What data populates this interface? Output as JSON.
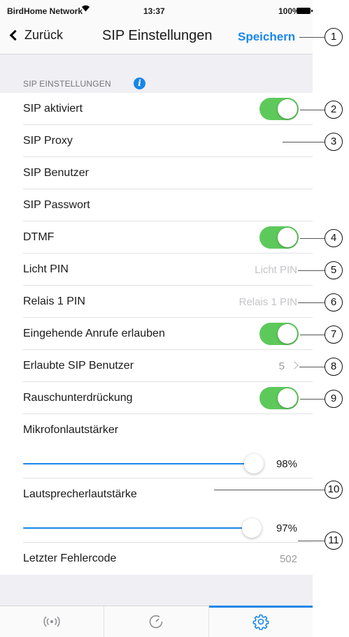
{
  "status_bar": {
    "carrier": "BirdHome Network",
    "wifi_icon": "wifi-icon",
    "time": "13:37",
    "battery": "100%"
  },
  "nav": {
    "back_label": "Zurück",
    "title": "SIP Einstellungen",
    "save_label": "Speichern"
  },
  "section": {
    "title": "SIP EINSTELLUNGEN",
    "info_glyph": "i"
  },
  "rows": {
    "sip_enabled": {
      "label": "SIP aktiviert",
      "toggle": true
    },
    "sip_proxy": {
      "label": "SIP Proxy"
    },
    "sip_user": {
      "label": "SIP Benutzer"
    },
    "sip_password": {
      "label": "SIP Passwort"
    },
    "dtmf": {
      "label": "DTMF",
      "toggle": true
    },
    "light_pin": {
      "label": "Licht PIN",
      "placeholder": "Licht PIN"
    },
    "relay_pin": {
      "label": "Relais 1 PIN",
      "placeholder": "Relais 1 PIN"
    },
    "incoming_calls": {
      "label": "Eingehende Anrufe erlauben",
      "toggle": true
    },
    "allowed_users": {
      "label": "Erlaubte SIP Benutzer",
      "value": "5"
    },
    "noise_suppression": {
      "label": "Rauschunterdrückung",
      "toggle": true
    },
    "mic_volume": {
      "label": "Mikrofonlautstärker",
      "value_text": "98%",
      "value": 0.98
    },
    "speaker_volume": {
      "label": "Lautsprecherlautstärke",
      "value_text": "97%",
      "value": 0.97
    },
    "last_error": {
      "label": "Letzter Fehlercode",
      "value": "502"
    }
  },
  "tabs": [
    {
      "icon": "broadcast-icon",
      "active": false
    },
    {
      "icon": "clock-icon",
      "active": false
    },
    {
      "icon": "gear-icon",
      "active": true
    }
  ],
  "callouts": [
    "1",
    "2",
    "3",
    "4",
    "5",
    "6",
    "7",
    "8",
    "9",
    "10",
    "11"
  ],
  "colors": {
    "accent": "#1a86e8",
    "toggle_on": "#5ec95b",
    "background": "#efeff4"
  }
}
